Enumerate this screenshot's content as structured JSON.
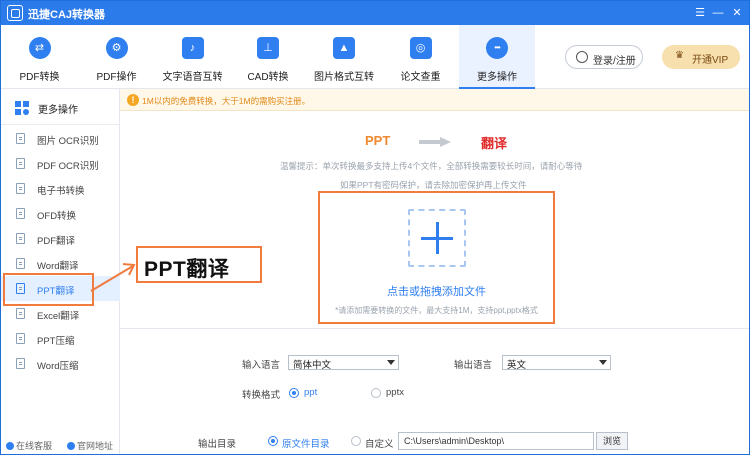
{
  "app": {
    "title": "迅捷CAJ转换器"
  },
  "window": {
    "menu": "☰",
    "minimize": "—",
    "close": "✕"
  },
  "toolbar": {
    "tools": [
      {
        "label": "PDF转换",
        "icon": "⇄"
      },
      {
        "label": "PDF操作",
        "icon": "⚙"
      },
      {
        "label": "文字语音互转",
        "icon": "♪"
      },
      {
        "label": "CAD转换",
        "icon": "⊥"
      },
      {
        "label": "图片格式互转",
        "icon": "▲"
      },
      {
        "label": "论文查重",
        "icon": "◎"
      },
      {
        "label": "更多操作",
        "icon": "•••"
      }
    ],
    "active_index": 6,
    "login_label": "登录/注册",
    "vip_label": "开通VIP",
    "vip_icon": "♛"
  },
  "sidebar": {
    "header": "更多操作",
    "items": [
      "图片 OCR识别",
      "PDF OCR识别",
      "电子书转换",
      "OFD转换",
      "PDF翻译",
      "Word翻译",
      "PPT翻译",
      "Excel翻译",
      "PPT压缩",
      "Word压缩"
    ],
    "active_index": 6,
    "footer_service": "在线客服",
    "footer_site": "官网地址"
  },
  "notice": {
    "icon": "!",
    "text": "1M以内的免费转换，大于1M的需购买注册。"
  },
  "flow": {
    "from": "PPT",
    "to": "翻译"
  },
  "tips": {
    "line1": "温馨提示：单次转换最多支持上传4个文件，全部转换需要较长时间，请耐心等待",
    "line2": "如果PPT有密码保护，请去除加密保护再上传文件"
  },
  "dropzone": {
    "title": "点击或拖拽添加文件",
    "subtitle": "*请添加需要转换的文件，最大支持1M，支持ppt,pptx格式"
  },
  "callout": {
    "text": "PPT翻译"
  },
  "settings": {
    "input_lang_label": "输入语言",
    "input_lang_value": "简体中文",
    "output_lang_label": "输出语言",
    "output_lang_value": "英文",
    "format_label": "转换格式",
    "format_options": [
      "ppt",
      "pptx"
    ],
    "format_selected": "ppt",
    "output_dir_label": "输出目录",
    "dir_options": [
      "原文件目录",
      "自定义"
    ],
    "dir_selected": "原文件目录",
    "path_value": "C:\\Users\\admin\\Desktop\\",
    "browse_label": "浏览"
  },
  "colors": {
    "brand": "#2b7bea",
    "accent_orange": "#f07b3f",
    "notice_text": "#e08a1a",
    "translate_red": "#e02c2c"
  }
}
